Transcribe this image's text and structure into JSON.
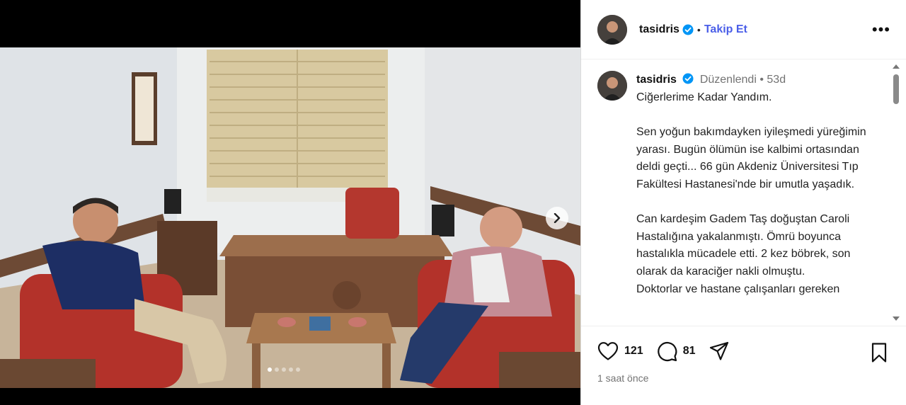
{
  "post": {
    "username": "tasidris",
    "follow_label": "Takip Et",
    "separator": "•",
    "more_label": "•••",
    "carousel": {
      "total_slides": 5,
      "active_index": 0
    }
  },
  "caption": {
    "username": "tasidris",
    "edited_label": "Düzenlendi",
    "separator": "•",
    "time": "53d",
    "text": "Ciğerlerime Kadar Yandım.\n\nSen yoğun bakımdayken iyileşmedi yüreğimin yarası. Bugün ölümün ise kalbimi ortasından deldi geçti... 66 gün Akdeniz Üniversitesi Tıp Fakültesi Hastanesi'nde bir umutla yaşadık.\n\nCan kardeşim Gadem Taş doğuştan Caroli Hastalığına yakalanmıştı. Ömrü boyunca hastalıkla mücadele etti. 2 kez böbrek, son olarak da karaciğer nakli olmuştu.\nDoktorlar ve hastane çalışanları gereken"
  },
  "actions": {
    "likes": "121",
    "comments": "81",
    "posted_ago": "1 saat önce"
  },
  "colors": {
    "accent": "#4a5ee8",
    "verified": "#0095f6",
    "muted": "#737373"
  },
  "icons": [
    "verified-badge-icon",
    "more-icon",
    "heart-icon",
    "comment-icon",
    "share-icon",
    "bookmark-icon",
    "chevron-right-icon"
  ]
}
